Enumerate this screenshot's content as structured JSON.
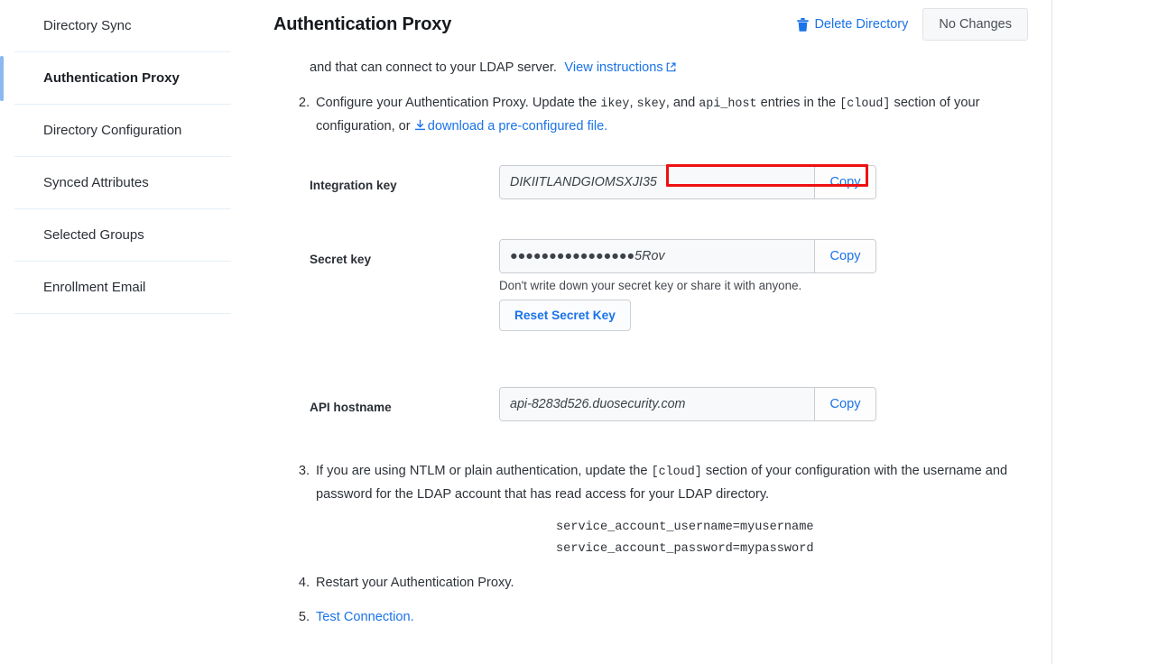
{
  "sidebar": {
    "items": [
      {
        "label": "Directory Sync",
        "active": false
      },
      {
        "label": "Authentication Proxy",
        "active": true
      },
      {
        "label": "Directory Configuration",
        "active": false
      },
      {
        "label": "Synced Attributes",
        "active": false
      },
      {
        "label": "Selected Groups",
        "active": false
      },
      {
        "label": "Enrollment Email",
        "active": false
      }
    ]
  },
  "header": {
    "title": "Authentication Proxy",
    "delete_label": "Delete Directory",
    "delete_icon": "trash-icon",
    "save_label": "No Changes"
  },
  "content": {
    "intro_tail": "and that can connect to your LDAP server.",
    "view_instructions_label": "View instructions",
    "view_instructions_icon": "external-link-icon",
    "step2": {
      "number": "2.",
      "text_a": "Configure your Authentication Proxy. Update the ",
      "code_ikey": "ikey",
      "text_b": ", ",
      "code_skey": "skey",
      "text_c": ", and ",
      "code_api_host": "api_host",
      "text_d": " entries in the ",
      "code_cloud": "[cloud]",
      "text_e": " section of your configuration, or",
      "download_icon": "download-icon",
      "download_label": "download a pre-configured file."
    },
    "fields": [
      {
        "label": "Integration key",
        "value": "DIKIITLANDGIOMSXJI35",
        "copy_label": "Copy"
      },
      {
        "label": "Secret key",
        "value": "●●●●●●●●●●●●●●●●5Rov",
        "copy_label": "Copy",
        "hint": "Don't write down your secret key or share it with anyone.",
        "reset_label": "Reset Secret Key"
      },
      {
        "label": "API hostname",
        "value": "api-8283d526.duosecurity.com",
        "copy_label": "Copy"
      }
    ],
    "step3": {
      "number": "3.",
      "text_a": "If you are using NTLM or plain authentication, update the ",
      "code_cloud": "[cloud]",
      "text_b": " section of your configuration with the username and password for the LDAP account that has read access for your LDAP directory.",
      "code_line1": "service_account_username=myusername",
      "code_line2": "service_account_password=mypassword"
    },
    "step4": {
      "number": "4.",
      "text": "Restart your Authentication Proxy."
    },
    "step5": {
      "number": "5.",
      "link_label": "Test Connection."
    }
  },
  "colors": {
    "link": "#1a73e8",
    "highlight_box": "#ee1111",
    "active_bar": "#8ab8f0",
    "divider": "#e4f0f8"
  }
}
